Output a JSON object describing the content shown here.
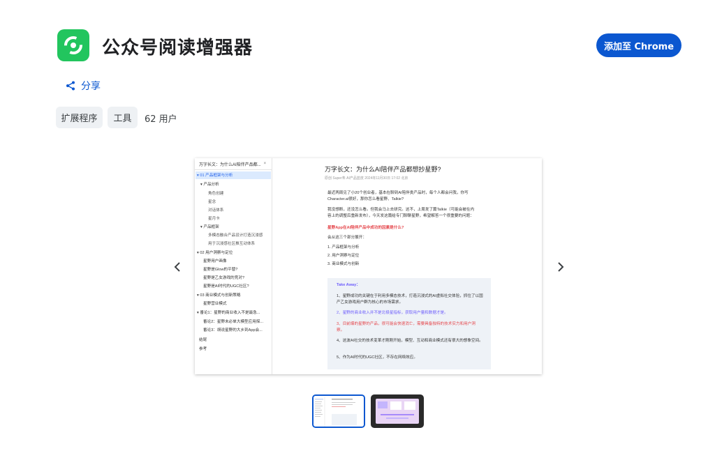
{
  "header": {
    "title": "公众号阅读增强器",
    "add_button": "添加至 Chrome",
    "logo_icon": "wechat-reader-logo-icon",
    "logo_color": "#22c55e"
  },
  "share": {
    "label": "分享",
    "icon": "share-icon"
  },
  "tags": {
    "category": "扩展程序",
    "subcategory": "工具",
    "users": "62 用户"
  },
  "accent": "#0b57d0",
  "screenshot": {
    "tab_title": "万字长文：为什么AI陪伴产品都...",
    "tab_close": "×",
    "toc": [
      "▾ 01 产品框架与分析",
      "▾ 产品分析",
      "角色创建",
      "星念",
      "对话体系",
      "星月卡",
      "▾ 产品框架",
      "多模态融合产品设计打造沉浸感",
      "用于沉浸感社区推互动体系",
      "▾ 02 用户洞察与定位",
      "星野用户画像",
      "星野是Glow的平替?",
      "星野是乙女游戏的竞对?",
      "星野是AI时代的UGC社区?",
      "▾ 03 商业模式与创新策略",
      "星野营业模式",
      "▾ 番论1：星野的商业收入不是最急...",
      "番论2：星野未必单大模型应用探...",
      "番论3：胡说星野的大乡到App会...",
      "结尾",
      "参考"
    ],
    "article_title": "万字长文：为什么AI陪伴产品都想抄星野?",
    "article_meta": "原创 Super朱  AI产品蓝皮  2024年11月30日 17:02  北京",
    "para1": "最近两周见了小20个创业者，基本在聊到AI陪伴类产品时，每个人都会问我，你写Character.ai很好，那你怎么看星野、Talkie?",
    "para2": "我没想断，还没怎么看。但我会马上去研究。这不，上周发了篇Talkie（可能会被在内容上的调整后重新发布），今天发这篇给专门聊聊星野，希望解答一个很重要的问题：",
    "question": "星野App在AI陪伴产品中成功的因素是什么?",
    "intro": "会从这三个部分展开：",
    "points": [
      "1. 产品框架与分析",
      "2. 用户洞察与定位",
      "3. 商业模式与创新"
    ],
    "takeaway": {
      "title": "Take Away：",
      "items": [
        "1、星野成功的关键在于利用多模态技术，打造沉浸式的AI虚拟社交体验，抓住了以国产乙女游戏用户群为核心的市场需求。",
        "2、星野的商业收入并不是北极星指标，获取用户量和数据才是。",
        "3、目前爆的星野的产品，很可能会快速消亡，需要具备独特的技术实力和用户洞察。",
        "4、这波AI社交的技术变革才刚刚开始，模型、互动和商业模式还有很大的想象空间。",
        "5、作为AI时代的UGC社区，不存在网络效应。"
      ]
    }
  },
  "carousel": {
    "prev_icon": "chevron-left-icon",
    "next_icon": "chevron-right-icon",
    "thumb_count": 2,
    "selected": 1
  }
}
